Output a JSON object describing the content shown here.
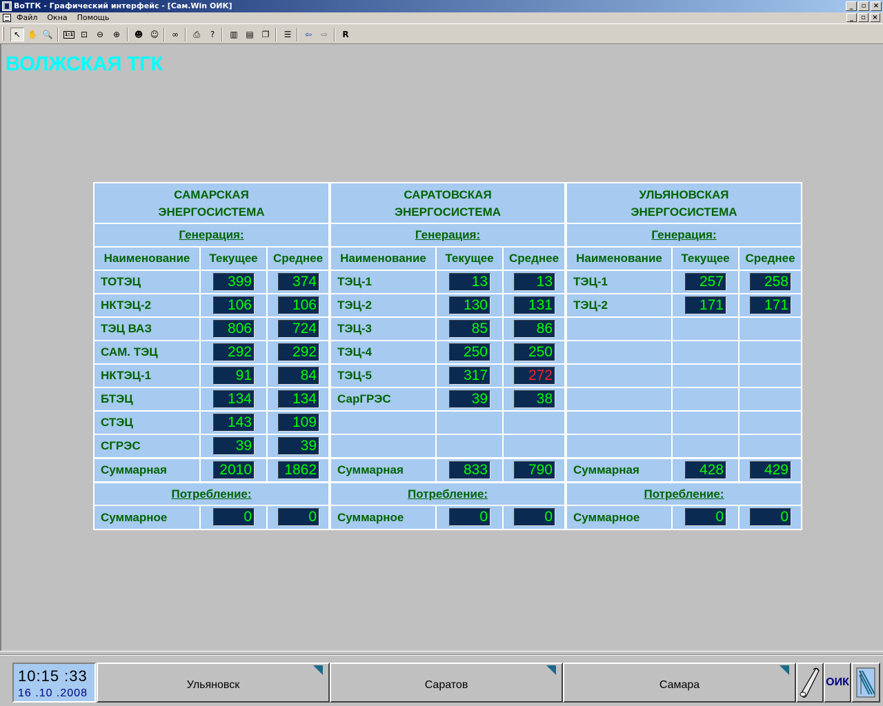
{
  "window": {
    "title": "ВоТГК - Графический интерфейс - [Сам.Win ОИК]",
    "controls": [
      "_",
      "▫",
      "×"
    ]
  },
  "menu": {
    "items": [
      "Файл",
      "Окна",
      "Помощь"
    ]
  },
  "toolbar": {
    "tools": [
      {
        "name": "pointer-icon",
        "glyph": "↖"
      },
      {
        "name": "hand-icon",
        "glyph": "✋"
      },
      {
        "name": "magnifier-icon",
        "glyph": "🔍"
      },
      {
        "name": "actual-size-icon",
        "glyph": "1:1"
      },
      {
        "name": "zoom-fit-icon",
        "glyph": "⊡"
      },
      {
        "name": "zoom-out-icon",
        "glyph": "⊖"
      },
      {
        "name": "zoom-in-icon",
        "glyph": "⊕"
      },
      {
        "name": "person-icon",
        "glyph": "☻"
      },
      {
        "name": "person-alt-icon",
        "glyph": "☺"
      },
      {
        "name": "binoculars-icon",
        "glyph": "∞"
      },
      {
        "name": "print-icon",
        "glyph": "⎙"
      },
      {
        "name": "help-icon",
        "glyph": "?"
      },
      {
        "name": "tile-vertical-icon",
        "glyph": "▥"
      },
      {
        "name": "tile-horizontal-icon",
        "glyph": "▤"
      },
      {
        "name": "cascade-icon",
        "glyph": "❐"
      },
      {
        "name": "window-list-icon",
        "glyph": "☰"
      },
      {
        "name": "back-icon",
        "glyph": "⇦"
      },
      {
        "name": "forward-icon",
        "glyph": "⇨"
      },
      {
        "name": "refresh-r-icon",
        "glyph": "R"
      }
    ]
  },
  "main": {
    "title": "ВОЛЖСКАЯ ТГК"
  },
  "systems": [
    {
      "title_line1": "САМАРСКАЯ",
      "title_line2": "ЭНЕРГОСИСТЕМА",
      "generation_label": "Генерация:",
      "col_name": "Наименование",
      "col_current": "Текущее",
      "col_average": "Среднее",
      "rows": [
        {
          "name": "ТОТЭЦ",
          "current": "399",
          "average": "374"
        },
        {
          "name": "НКТЭЦ-2",
          "current": "106",
          "average": "106"
        },
        {
          "name": "ТЭЦ ВАЗ",
          "current": "806",
          "average": "724"
        },
        {
          "name": "САМ. ТЭЦ",
          "current": "292",
          "average": "292"
        },
        {
          "name": "НКТЭЦ-1",
          "current": "91",
          "average": "84"
        },
        {
          "name": "БТЭЦ",
          "current": "134",
          "average": "134"
        },
        {
          "name": "СТЭЦ",
          "current": "143",
          "average": "109"
        },
        {
          "name": "СГРЭС",
          "current": "39",
          "average": "39"
        }
      ],
      "total_label": "Суммарная",
      "total_current": "2010",
      "total_average": "1862",
      "consumption_label": "Потребление:",
      "consumption_name": "Суммарное",
      "consumption_current": "0",
      "consumption_average": "0"
    },
    {
      "title_line1": "САРАТОВСКАЯ",
      "title_line2": "ЭНЕРГОСИСТЕМА",
      "generation_label": "Генерация:",
      "col_name": "Наименование",
      "col_current": "Текущее",
      "col_average": "Среднее",
      "rows": [
        {
          "name": "ТЭЦ-1",
          "current": "13",
          "average": "13"
        },
        {
          "name": "ТЭЦ-2",
          "current": "130",
          "average": "131"
        },
        {
          "name": "ТЭЦ-3",
          "current": "85",
          "average": "86"
        },
        {
          "name": "ТЭЦ-4",
          "current": "250",
          "average": "250"
        },
        {
          "name": "ТЭЦ-5",
          "current": "317",
          "average": "272",
          "average_alarm": true
        },
        {
          "name": "СарГРЭС",
          "current": "39",
          "average": "38"
        },
        null,
        null
      ],
      "total_label": "Суммарная",
      "total_current": "833",
      "total_average": "790",
      "consumption_label": "Потребление:",
      "consumption_name": "Суммарное",
      "consumption_current": "0",
      "consumption_average": "0"
    },
    {
      "title_line1": "УЛЬЯНОВСКАЯ",
      "title_line2": "ЭНЕРГОСИСТЕМА",
      "generation_label": "Генерация:",
      "col_name": "Наименование",
      "col_current": "Текущее",
      "col_average": "Среднее",
      "rows": [
        {
          "name": "ТЭЦ-1",
          "current": "257",
          "average": "258"
        },
        {
          "name": "ТЭЦ-2",
          "current": "171",
          "average": "171"
        },
        null,
        null,
        null,
        null,
        null,
        null
      ],
      "total_label": "Суммарная",
      "total_current": "428",
      "total_average": "429",
      "consumption_label": "Потребление:",
      "consumption_name": "Суммарное",
      "consumption_current": "0",
      "consumption_average": "0"
    }
  ],
  "colors": {
    "cell_bg": "#a6caf0",
    "text_green": "#006400",
    "lcd_bg": "#0b2a52",
    "lcd_text": "#00ff00",
    "lcd_alarm": "#ff2020",
    "title_cyan": "#00ffff"
  },
  "bottom": {
    "time": "10:15 :33",
    "date": "16 .10 .2008",
    "nav": [
      "Ульяновск",
      "Саратов",
      "Самара"
    ],
    "oik_label": "ОИК"
  }
}
